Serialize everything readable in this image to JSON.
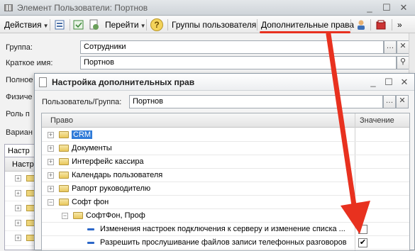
{
  "main_window": {
    "title": "Элемент Пользователи: Портнов",
    "controls": {
      "minimize": "_",
      "maximize": "☐",
      "close": "✕"
    }
  },
  "toolbar": {
    "actions_label": "Действия",
    "goto_label": "Перейти",
    "help_label": "?",
    "user_groups_label": "Группы пользователя",
    "extra_rights_label": "Дополнительные права"
  },
  "form": {
    "group_label": "Группа:",
    "group_value": "Сотрудники",
    "short_name_label": "Краткое имя:",
    "short_name_value": "Портнов",
    "full_label": "Полное",
    "phys_label": "Физиче",
    "role_label": "Роль п",
    "variant_label": "Вариан",
    "tab_label": "Настр",
    "left_grid_header": "Настр"
  },
  "dialog": {
    "title": "Настройка дополнительных прав",
    "user_group_label": "Пользователь/Группа:",
    "user_group_value": "Портнов",
    "columns": {
      "right": "Право",
      "value": "Значение"
    },
    "rows": [
      {
        "label": "CRM",
        "type": "folder",
        "level": 0,
        "toggle": "+",
        "highlight": true
      },
      {
        "label": "Документы",
        "type": "folder",
        "level": 0,
        "toggle": "+"
      },
      {
        "label": "Интерфейс кассира",
        "type": "folder",
        "level": 0,
        "toggle": "+"
      },
      {
        "label": "Календарь пользователя",
        "type": "folder",
        "level": 0,
        "toggle": "+"
      },
      {
        "label": "Рапорт руководителю",
        "type": "folder",
        "level": 0,
        "toggle": "+"
      },
      {
        "label": "Софт фон",
        "type": "folder",
        "level": 0,
        "toggle": "−"
      },
      {
        "label": "СофтФон, Проф",
        "type": "folder",
        "level": 1,
        "toggle": "−"
      },
      {
        "label": "Изменения настроек подключения к серверу и изменение списка ...",
        "type": "leaf",
        "level": 2,
        "checked": false
      },
      {
        "label": "Разрешить прослушивание файлов записи телефонных разговоров",
        "type": "leaf",
        "level": 2,
        "checked": true
      }
    ]
  },
  "annotation": {
    "arrow_color": "#e8311f",
    "underline_color": "#e8311f"
  }
}
